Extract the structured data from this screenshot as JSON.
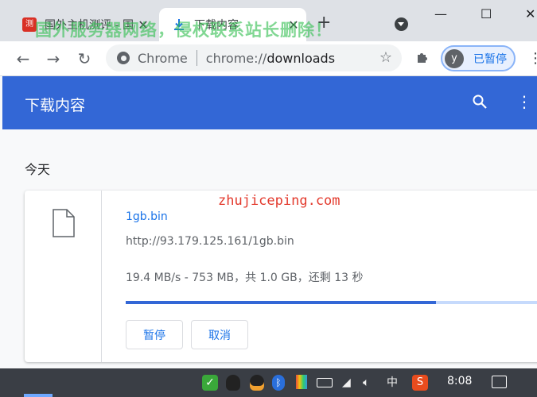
{
  "window": {
    "tabs": [
      {
        "title": "国外主机测评 - 国",
        "active": false
      },
      {
        "title": "下载内容",
        "active": true
      }
    ],
    "new_tab_label": "+",
    "controls": {
      "minimize": "—",
      "maximize": "☐",
      "close": "✕"
    },
    "watermark": "国外服务器网络，侵权联系站长删除！"
  },
  "toolbar": {
    "omnibox_chip": "Chrome",
    "url_host": "chrome://",
    "url_path": "downloads",
    "profile_initial": "y",
    "profile_label": "已暂停"
  },
  "page": {
    "header_title": "下载内容",
    "section_date": "今天",
    "download": {
      "file_name": "1gb.bin",
      "url": "http://93.179.125.161/1gb.bin",
      "status": "19.4 MB/s - 753 MB，共 1.0 GB，还剩 13 秒",
      "progress_percent": 75,
      "pause_label": "暂停",
      "cancel_label": "取消"
    },
    "site_watermark": "zhujiceping.com"
  },
  "taskbar": {
    "ime_label": "中",
    "clock": "8:08"
  },
  "colors": {
    "header_blue": "#3367d6",
    "accent_blue": "#1a73e8",
    "watermark_green": "#34be50",
    "site_watermark_red": "#e33a2d"
  }
}
